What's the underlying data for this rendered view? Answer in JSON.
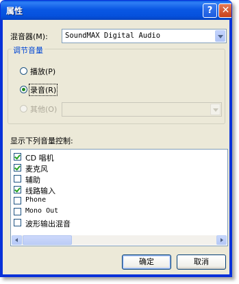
{
  "window": {
    "title": "属性",
    "help_glyph": "?",
    "close_glyph": "✕"
  },
  "mixer": {
    "label": "混音器(M):",
    "value": "SoundMAX Digital Audio"
  },
  "volume_group": {
    "title": "调节音量",
    "options": [
      {
        "label": "播放(P)",
        "checked": false,
        "disabled": false
      },
      {
        "label": "录音(R)",
        "checked": true,
        "disabled": false
      },
      {
        "label": "其他(O)",
        "checked": false,
        "disabled": true
      }
    ]
  },
  "controls": {
    "label": "显示下列音量控制:",
    "items": [
      {
        "label": "CD 唱机",
        "checked": true
      },
      {
        "label": "麦克风",
        "checked": true
      },
      {
        "label": "辅助",
        "checked": false
      },
      {
        "label": "线路输入",
        "checked": true
      },
      {
        "label": "Phone",
        "checked": false
      },
      {
        "label": "Mono Out",
        "checked": false
      },
      {
        "label": "波形输出混音",
        "checked": false
      }
    ]
  },
  "buttons": {
    "ok": "确定",
    "cancel": "取消"
  }
}
